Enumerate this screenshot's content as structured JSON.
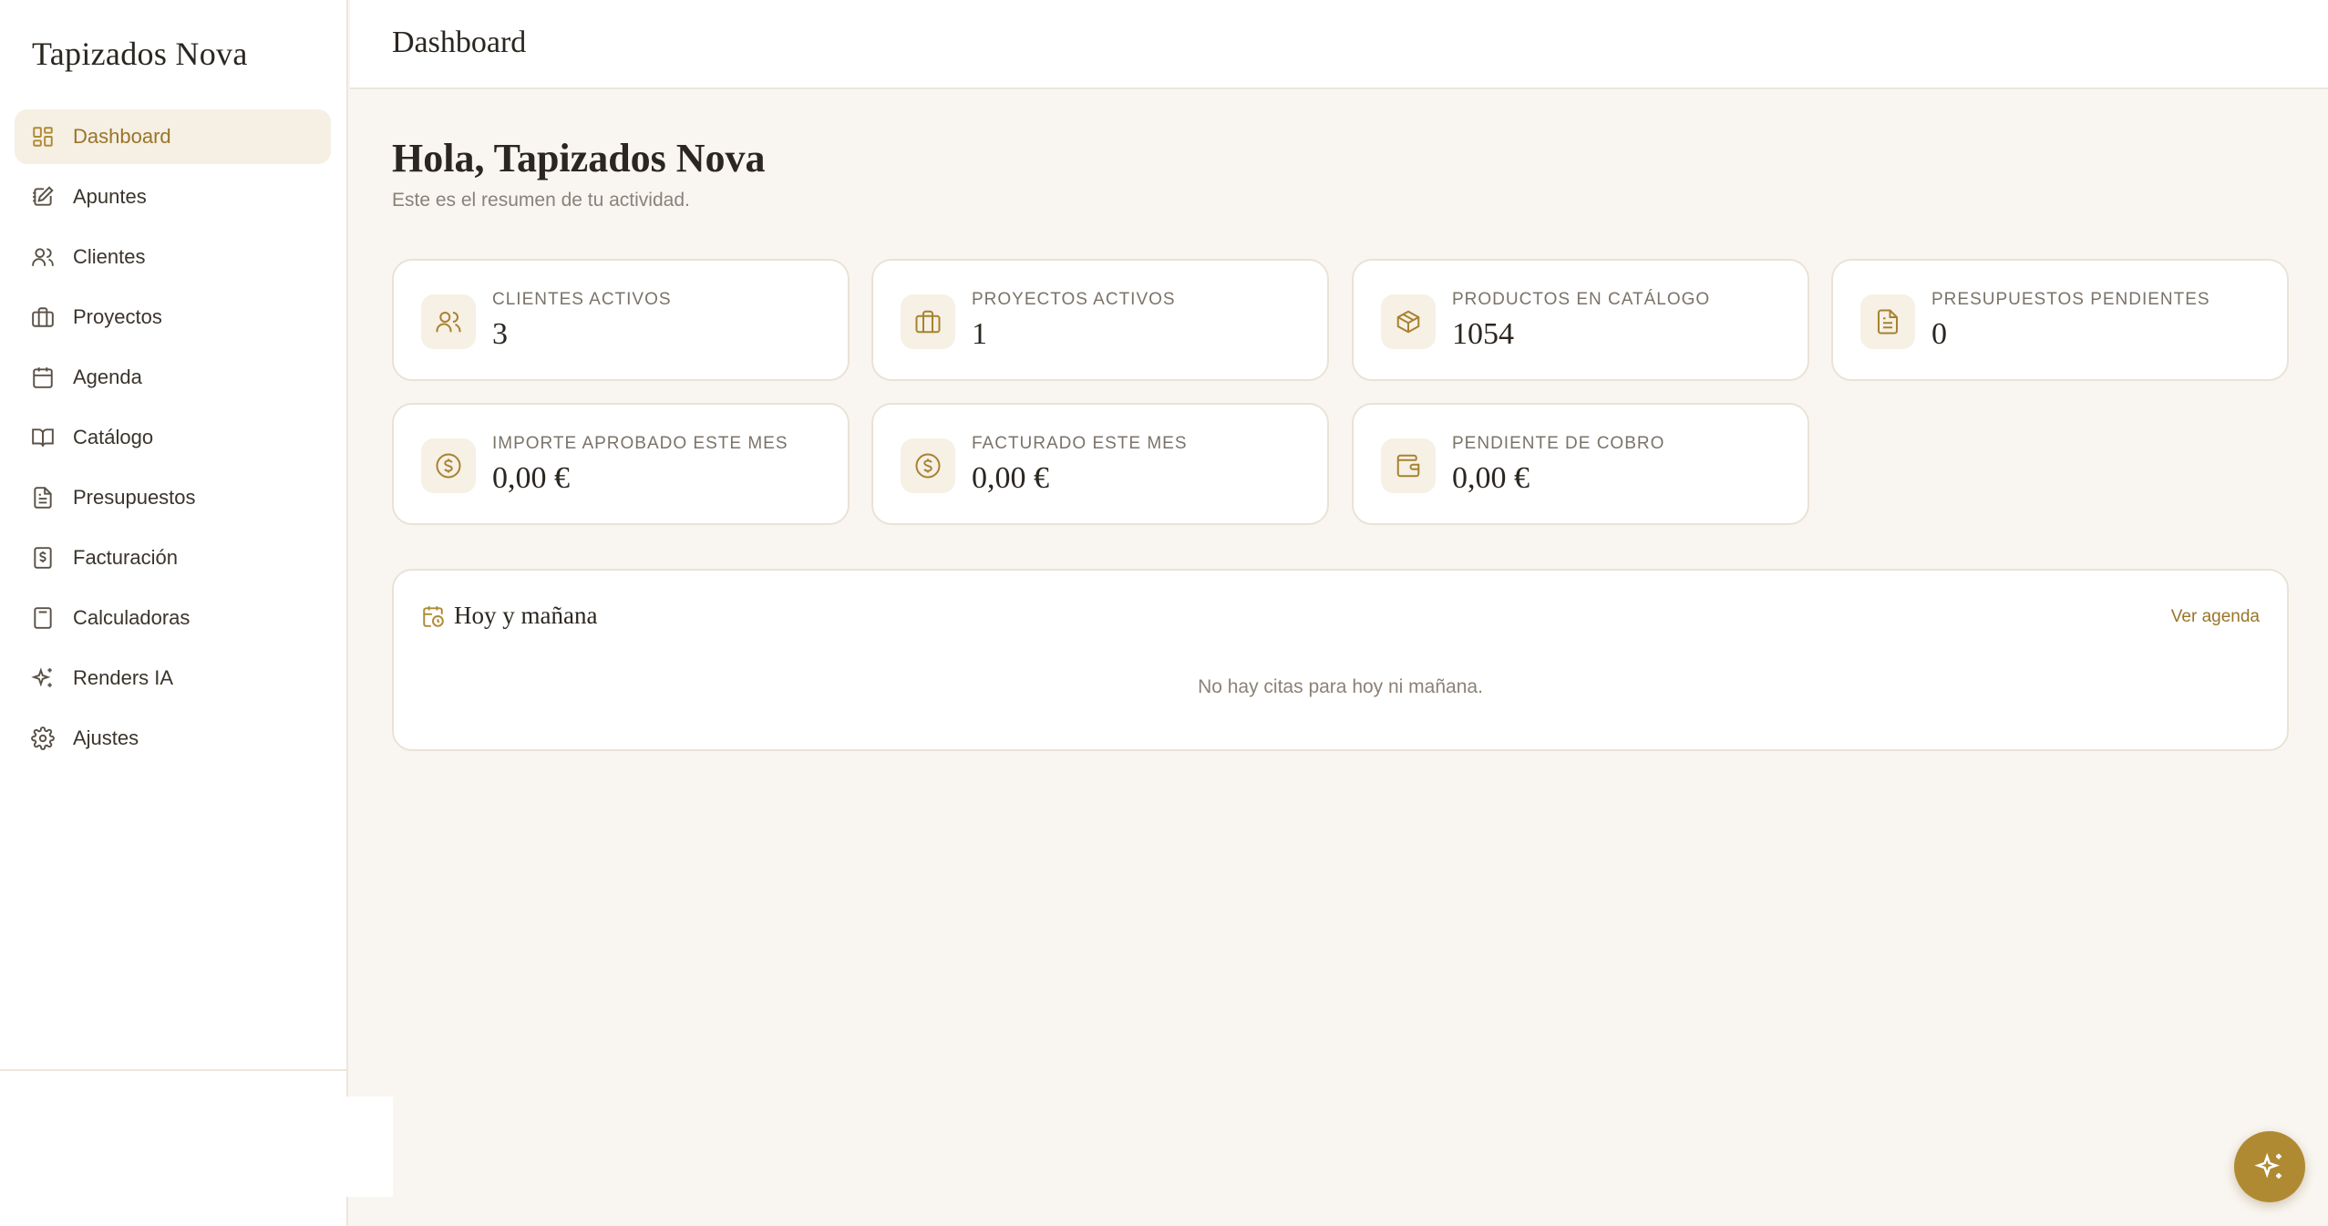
{
  "brand": "Tapizados Nova",
  "header": {
    "title": "Dashboard"
  },
  "sidebar": {
    "items": [
      {
        "label": "Dashboard",
        "icon": "dashboard-grid-icon",
        "active": true
      },
      {
        "label": "Apuntes",
        "icon": "notes-icon",
        "active": false
      },
      {
        "label": "Clientes",
        "icon": "users-icon",
        "active": false
      },
      {
        "label": "Proyectos",
        "icon": "briefcase-icon",
        "active": false
      },
      {
        "label": "Agenda",
        "icon": "calendar-icon",
        "active": false
      },
      {
        "label": "Catálogo",
        "icon": "book-icon",
        "active": false
      },
      {
        "label": "Presupuestos",
        "icon": "document-icon",
        "active": false
      },
      {
        "label": "Facturación",
        "icon": "invoice-icon",
        "active": false
      },
      {
        "label": "Calculadoras",
        "icon": "calculator-icon",
        "active": false
      },
      {
        "label": "Renders IA",
        "icon": "sparkles-icon",
        "active": false
      },
      {
        "label": "Ajustes",
        "icon": "gear-icon",
        "active": false
      }
    ]
  },
  "main": {
    "greeting": "Hola, Tapizados Nova",
    "subtitle": "Este es el resumen de tu actividad.",
    "stats": [
      {
        "label": "CLIENTES ACTIVOS",
        "value": "3",
        "icon": "users-icon"
      },
      {
        "label": "PROYECTOS ACTIVOS",
        "value": "1",
        "icon": "briefcase-icon"
      },
      {
        "label": "PRODUCTOS EN CATÁLOGO",
        "value": "1054",
        "icon": "package-icon"
      },
      {
        "label": "PRESUPUESTOS PENDIENTES",
        "value": "0",
        "icon": "document-icon"
      },
      {
        "label": "IMPORTE APROBADO ESTE MES",
        "value": "0,00 €",
        "icon": "dollar-circle-icon"
      },
      {
        "label": "FACTURADO ESTE MES",
        "value": "0,00 €",
        "icon": "dollar-circle-icon"
      },
      {
        "label": "PENDIENTE DE COBRO",
        "value": "0,00 €",
        "icon": "wallet-icon"
      }
    ],
    "agenda": {
      "title": "Hoy y mañana",
      "link": "Ver agenda",
      "empty": "No hay citas para hoy ni mañana."
    }
  },
  "colors": {
    "accent": "#b08a32",
    "background": "#f9f6f1",
    "active_bg": "#f5efe4"
  }
}
